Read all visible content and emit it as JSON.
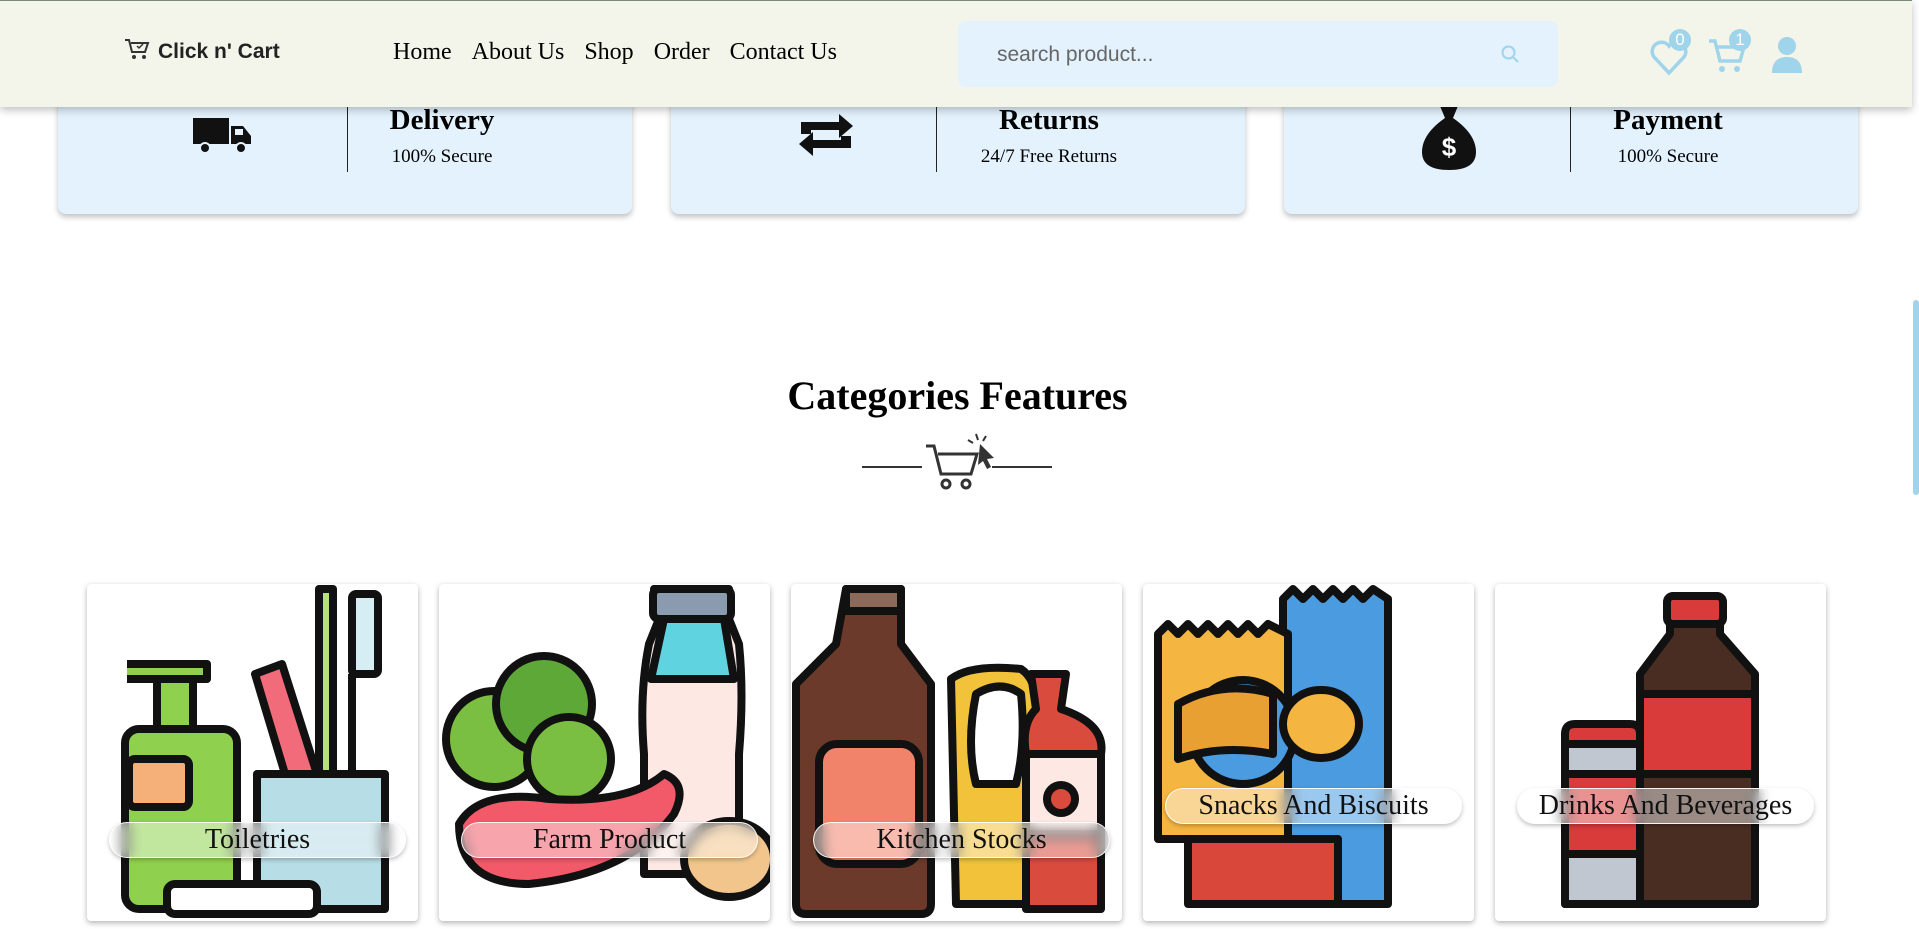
{
  "header": {
    "logo_text": "Click n' Cart",
    "nav": [
      "Home",
      "About Us",
      "Shop",
      "Order",
      "Contact Us"
    ],
    "search_placeholder": "search product...",
    "wishlist_count": "0",
    "cart_count": "1"
  },
  "features": [
    {
      "title": "Delivery",
      "subtitle": "100% Secure",
      "icon": "truck-icon"
    },
    {
      "title": "Returns",
      "subtitle": "24/7 Free Returns",
      "icon": "repeat-icon"
    },
    {
      "title": "Payment",
      "subtitle": "100% Secure",
      "icon": "money-bag-icon"
    }
  ],
  "section": {
    "title": "Categories Features"
  },
  "categories": [
    {
      "label": "Toiletries"
    },
    {
      "label": "Farm Product"
    },
    {
      "label": "Kitchen Stocks"
    },
    {
      "label": "Snacks And Biscuits"
    },
    {
      "label": "Drinks And Beverages"
    }
  ],
  "colors": {
    "header_bg": "#f3f5ea",
    "feature_bg": "#e3f2fd",
    "accent": "#9fd4ea"
  }
}
